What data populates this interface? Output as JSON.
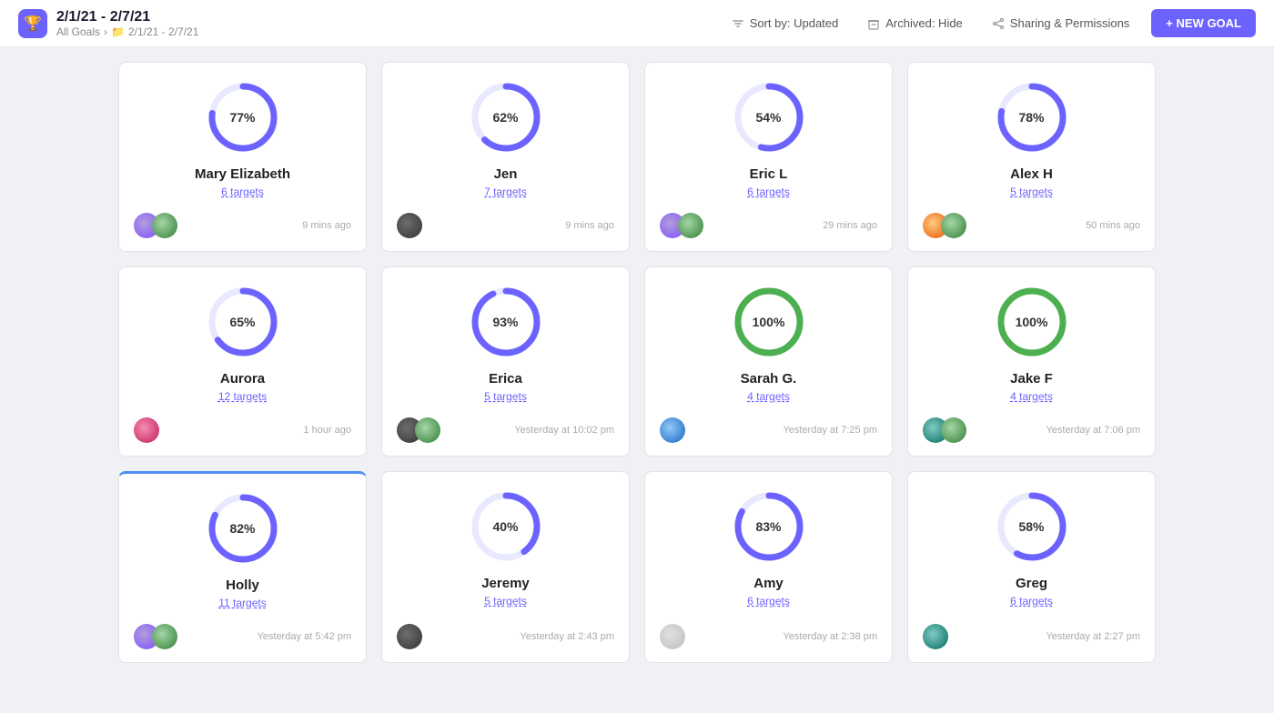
{
  "header": {
    "title": "2/1/21 - 2/7/21",
    "breadcrumb_all": "All Goals",
    "breadcrumb_sep": ">",
    "breadcrumb_folder_icon": "folder",
    "breadcrumb_date": "2/1/21 - 2/7/21",
    "sort_label": "Sort by: Updated",
    "archived_label": "Archived: Hide",
    "sharing_label": "Sharing & Permissions",
    "new_goal_label": "+ NEW GOAL"
  },
  "cards": [
    {
      "name": "Mary Elizabeth",
      "targets": "6 targets",
      "percent": 77,
      "time": "9 mins ago",
      "color": "#6c63ff",
      "bg_color": "#e8e8ff",
      "is_green": false,
      "avatar_class": "av-purple",
      "avatar2_class": "av-green",
      "active_top": false
    },
    {
      "name": "Jen",
      "targets": "7 targets",
      "percent": 62,
      "time": "9 mins ago",
      "color": "#6c63ff",
      "bg_color": "#e8e8ff",
      "is_green": false,
      "avatar_class": "av-dark",
      "avatar2_class": null,
      "active_top": false
    },
    {
      "name": "Eric L",
      "targets": "6 targets",
      "percent": 54,
      "time": "29 mins ago",
      "color": "#6c63ff",
      "bg_color": "#e8e8ff",
      "is_green": false,
      "avatar_class": "av-purple",
      "avatar2_class": "av-green",
      "active_top": false
    },
    {
      "name": "Alex H",
      "targets": "5 targets",
      "percent": 78,
      "time": "50 mins ago",
      "color": "#6c63ff",
      "bg_color": "#e8e8ff",
      "is_green": false,
      "avatar_class": "av-orange",
      "avatar2_class": "av-green",
      "active_top": false
    },
    {
      "name": "Aurora",
      "targets": "12 targets",
      "percent": 65,
      "time": "1 hour ago",
      "color": "#6c63ff",
      "bg_color": "#e8e8ff",
      "is_green": false,
      "avatar_class": "av-pink",
      "avatar2_class": null,
      "active_top": false
    },
    {
      "name": "Erica",
      "targets": "5 targets",
      "percent": 93,
      "time": "Yesterday at 10:02 pm",
      "color": "#6c63ff",
      "bg_color": "#e8e8ff",
      "is_green": false,
      "avatar_class": "av-dark",
      "avatar2_class": "av-green",
      "active_top": false
    },
    {
      "name": "Sarah G.",
      "targets": "4 targets",
      "percent": 100,
      "time": "Yesterday at 7:25 pm",
      "color": "#4caf50",
      "bg_color": "#e8f5e9",
      "is_green": true,
      "avatar_class": "av-blue",
      "avatar2_class": null,
      "active_top": false
    },
    {
      "name": "Jake F",
      "targets": "4 targets",
      "percent": 100,
      "time": "Yesterday at 7:06 pm",
      "color": "#4caf50",
      "bg_color": "#e8f5e9",
      "is_green": true,
      "avatar_class": "av-teal",
      "avatar2_class": "av-green",
      "active_top": false
    },
    {
      "name": "Holly",
      "targets": "11 targets",
      "percent": 82,
      "time": "Yesterday at 5:42 pm",
      "color": "#6c63ff",
      "bg_color": "#e8e8ff",
      "is_green": false,
      "avatar_class": "av-purple",
      "avatar2_class": "av-green",
      "active_top": true
    },
    {
      "name": "Jeremy",
      "targets": "5 targets",
      "percent": 40,
      "time": "Yesterday at 2:43 pm",
      "color": "#6c63ff",
      "bg_color": "#e8e8ff",
      "is_green": false,
      "avatar_class": "av-dark",
      "avatar2_class": null,
      "active_top": false
    },
    {
      "name": "Amy",
      "targets": "6 targets",
      "percent": 83,
      "time": "Yesterday at 2:38 pm",
      "color": "#6c63ff",
      "bg_color": "#e8e8ff",
      "is_green": false,
      "avatar_class": "av-gray",
      "avatar2_class": null,
      "active_top": false
    },
    {
      "name": "Greg",
      "targets": "6 targets",
      "percent": 58,
      "time": "Yesterday at 2:27 pm",
      "color": "#6c63ff",
      "bg_color": "#e8e8ff",
      "is_green": false,
      "avatar_class": "av-teal",
      "avatar2_class": null,
      "active_top": false
    }
  ]
}
